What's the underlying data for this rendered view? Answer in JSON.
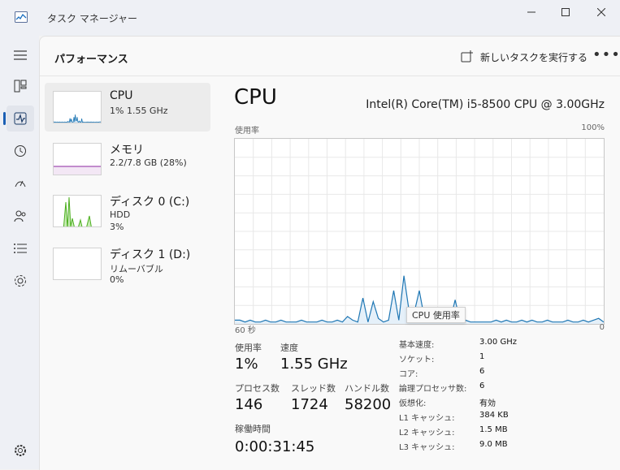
{
  "window": {
    "title": "タスク マネージャー"
  },
  "header": {
    "title": "パフォーマンス",
    "run_new_task": "新しいタスクを実行する",
    "more": "•••"
  },
  "sidebar": {
    "active": "performance",
    "items": [
      {
        "name": "menu",
        "icon": "hamburger-icon"
      },
      {
        "name": "processes",
        "icon": "processes-icon"
      },
      {
        "name": "performance",
        "icon": "performance-icon"
      },
      {
        "name": "app-history",
        "icon": "history-icon"
      },
      {
        "name": "startup-apps",
        "icon": "startup-icon"
      },
      {
        "name": "users",
        "icon": "users-icon"
      },
      {
        "name": "details",
        "icon": "details-icon"
      },
      {
        "name": "services",
        "icon": "services-icon"
      },
      {
        "name": "settings",
        "icon": "settings-icon"
      }
    ]
  },
  "resources": [
    {
      "name": "CPU",
      "line1": "1%  1.55 GHz",
      "line2": "",
      "selected": true,
      "color": "#1f77b4"
    },
    {
      "name": "メモリ",
      "line1": "2.2/7.8 GB (28%)",
      "line2": "",
      "selected": false,
      "color": "#8b27a0"
    },
    {
      "name": "ディスク 0 (C:)",
      "line1": "HDD",
      "line2": "3%",
      "selected": false,
      "color": "#4caf1f"
    },
    {
      "name": "ディスク 1 (D:)",
      "line1": "リムーバブル",
      "line2": "0%",
      "selected": false,
      "color": "#4caf1f"
    }
  ],
  "cpu": {
    "title": "CPU",
    "model": "Intel(R) Core(TM) i5-8500 CPU @ 3.00GHz",
    "graph_label_left": "使用率",
    "graph_label_right": "100%",
    "axis_left": "60 秒",
    "axis_right": "0",
    "tooltip": "CPU 使用率",
    "usage_percent_series": [
      2,
      2,
      1,
      2,
      1,
      1,
      2,
      1,
      1,
      2,
      1,
      1,
      1,
      2,
      1,
      1,
      1,
      2,
      1,
      1,
      2,
      1,
      4,
      2,
      1,
      14,
      1,
      12,
      3,
      1,
      2,
      18,
      2,
      26,
      7,
      6,
      18,
      3,
      1,
      5,
      1,
      3,
      1,
      13,
      1,
      2,
      1,
      1,
      1,
      1,
      1,
      2,
      1,
      2,
      1,
      1,
      2,
      1,
      2,
      1,
      1,
      2,
      1,
      1,
      1,
      2,
      1,
      1,
      2,
      1,
      2,
      3,
      1
    ]
  },
  "stats": {
    "usage": {
      "label": "使用率",
      "value": "1%"
    },
    "speed": {
      "label": "速度",
      "value": "1.55 GHz"
    },
    "processes": {
      "label": "プロセス数",
      "value": "146"
    },
    "threads": {
      "label": "スレッド数",
      "value": "1724"
    },
    "handles": {
      "label": "ハンドル数",
      "value": "58200"
    },
    "uptime": {
      "label": "稼働時間",
      "value": "0:00:31:45"
    }
  },
  "specs": [
    {
      "label": "基本速度:",
      "value": "3.00 GHz"
    },
    {
      "label": "ソケット:",
      "value": "1"
    },
    {
      "label": "コア:",
      "value": "6"
    },
    {
      "label": "論理プロセッサ数:",
      "value": "6"
    },
    {
      "label": "仮想化:",
      "value": "有効"
    },
    {
      "label": "L1 キャッシュ:",
      "value": "384 KB"
    },
    {
      "label": "L2 キャッシュ:",
      "value": "1.5 MB"
    },
    {
      "label": "L3 キャッシュ:",
      "value": "9.0 MB"
    }
  ]
}
